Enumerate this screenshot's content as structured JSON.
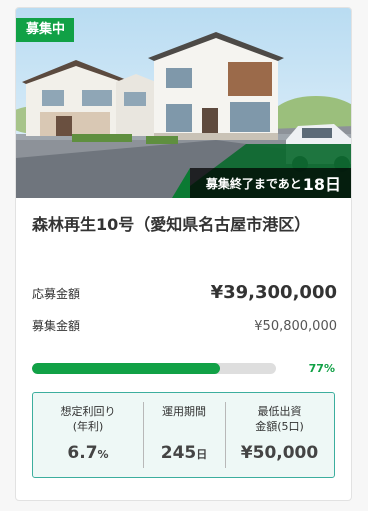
{
  "card": {
    "status_label": "募集中",
    "countdown_prefix": "募集終了まであと",
    "countdown_days": "18日",
    "title": "森林再生10号（愛知県名古屋市港区）",
    "apply_amount": {
      "label": "応募金額",
      "value": "¥39,300,000"
    },
    "raise_amount": {
      "label": "募集金額",
      "value": "¥50,800,000"
    },
    "progress": {
      "percent_label": "77%",
      "fraction": 0.77
    },
    "terms": [
      {
        "label_line1": "想定利回り",
        "label_line2": "(年利)",
        "value": "6.7",
        "unit": "%"
      },
      {
        "label_line1": "運用期間",
        "label_line2": "",
        "value": "245",
        "unit": "日"
      },
      {
        "label_line1": "最低出資",
        "label_line2": "金額(5口)",
        "value": "¥50,000",
        "unit": ""
      }
    ]
  },
  "colors": {
    "accent": "#11a146",
    "terms_border": "#3cae9e",
    "terms_bg": "#eef8f6"
  },
  "icons": [
    "house-photo"
  ]
}
